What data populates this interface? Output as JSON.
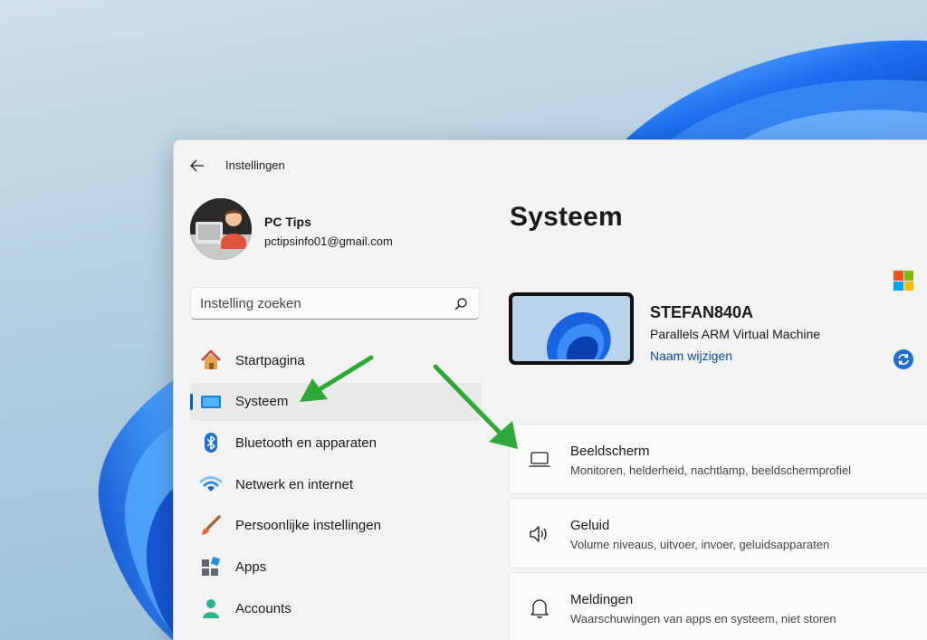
{
  "window": {
    "title": "Instellingen"
  },
  "profile": {
    "name": "PC Tips",
    "email": "pctipsinfo01@gmail.com"
  },
  "search": {
    "placeholder": "Instelling zoeken"
  },
  "nav": {
    "items": [
      {
        "label": "Startpagina",
        "icon": "home-icon",
        "active": false
      },
      {
        "label": "Systeem",
        "icon": "system-icon",
        "active": true
      },
      {
        "label": "Bluetooth en apparaten",
        "icon": "bluetooth-icon",
        "active": false
      },
      {
        "label": "Netwerk en internet",
        "icon": "wifi-icon",
        "active": false
      },
      {
        "label": "Persoonlijke instellingen",
        "icon": "brush-icon",
        "active": false
      },
      {
        "label": "Apps",
        "icon": "apps-icon",
        "active": false
      },
      {
        "label": "Accounts",
        "icon": "account-icon",
        "active": false
      }
    ]
  },
  "main": {
    "title": "Systeem",
    "device": {
      "name": "STEFAN840A",
      "model": "Parallels ARM Virtual Machine",
      "rename_link": "Naam wijzigen"
    },
    "cards": [
      {
        "title": "Beeldscherm",
        "desc": "Monitoren, helderheid, nachtlamp, beeldschermprofiel",
        "icon": "monitor-icon"
      },
      {
        "title": "Geluid",
        "desc": "Volume niveaus, uitvoer, invoer, geluidsapparaten",
        "icon": "speaker-icon"
      },
      {
        "title": "Meldingen",
        "desc": "Waarschuwingen van apps en systeem, niet storen",
        "icon": "bell-icon"
      }
    ]
  },
  "colors": {
    "accent": "#005fb8",
    "arrow": "#2ea836",
    "link": "#0a4ea3"
  }
}
